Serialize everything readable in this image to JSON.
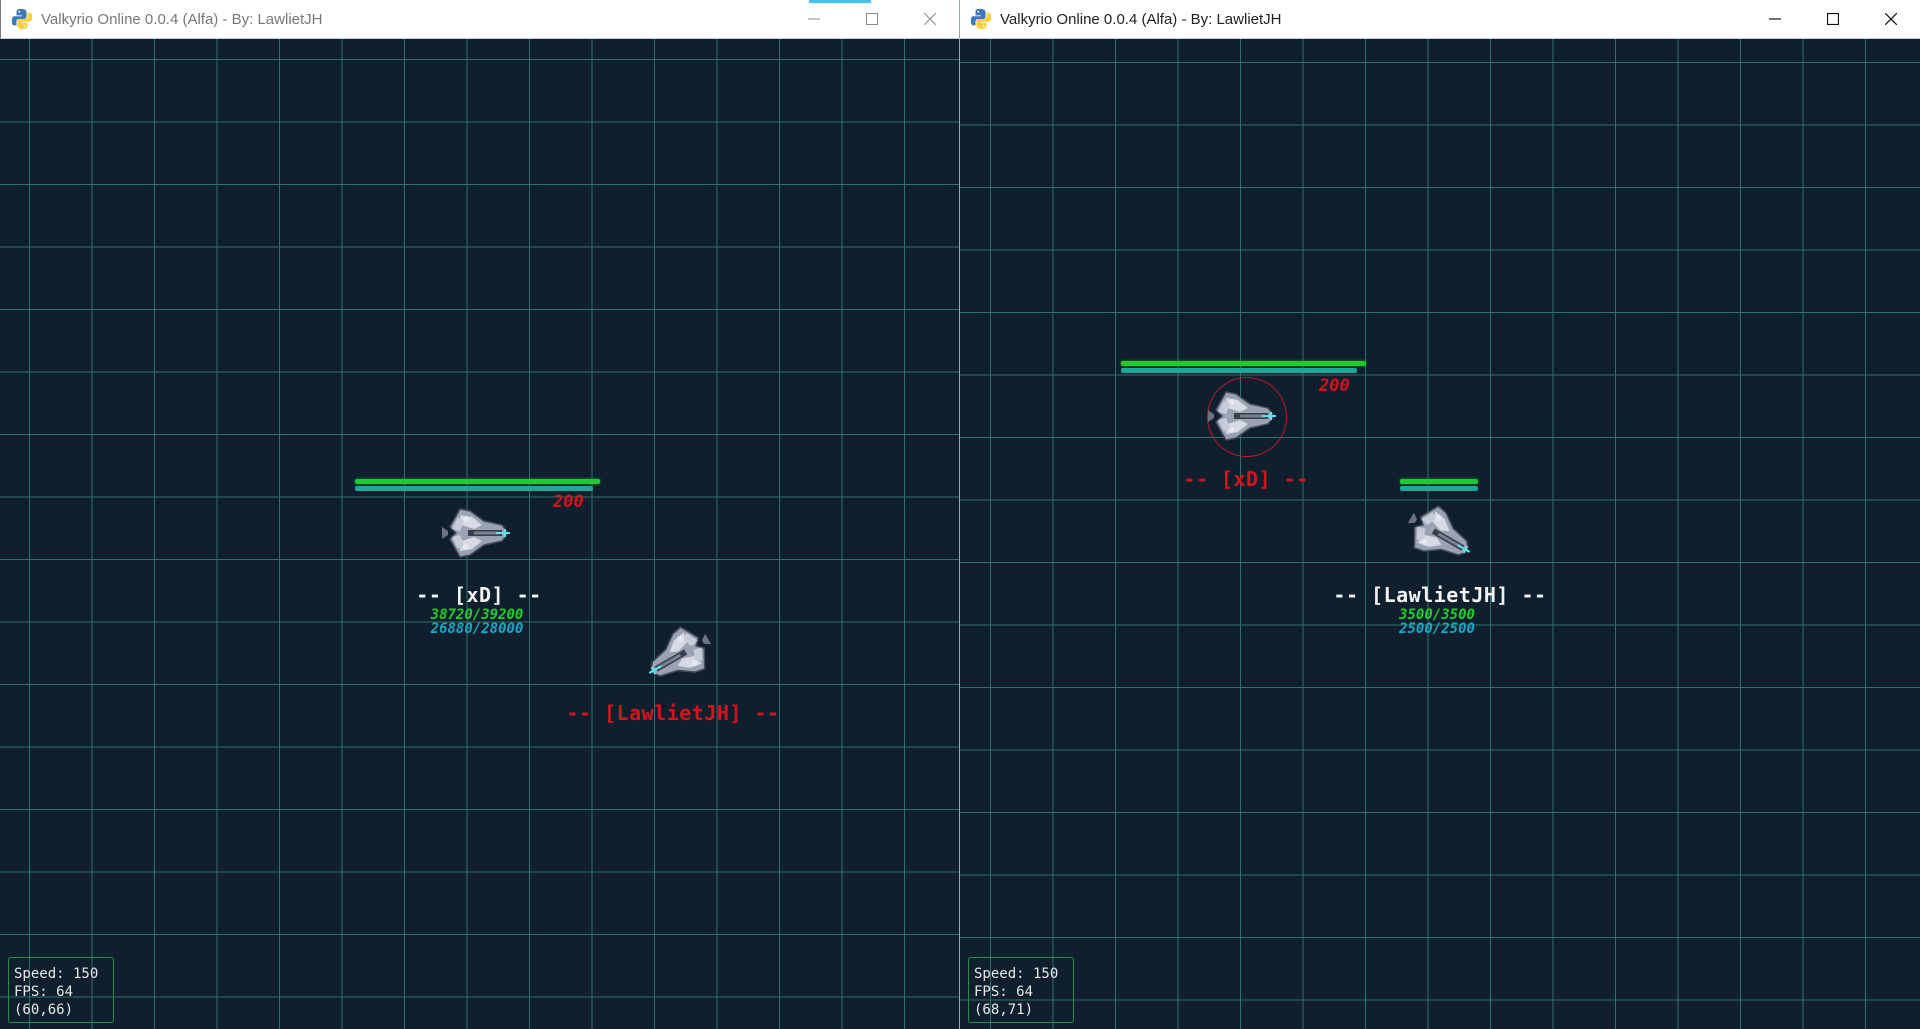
{
  "windows": [
    {
      "id": "left",
      "title": "Valkyrio Online 0.0.4 (Alfa) - By: LawlietJH",
      "focused": false,
      "self_ship": {
        "name_tag": "-- [xD] --",
        "damage_text": "200",
        "hp_text": "38720/39200",
        "sp_text": "26880/28000",
        "hp_fraction": 0.988,
        "sp_fraction": 0.96
      },
      "enemy_ship": {
        "name_tag": "-- [LawlietJH] --"
      },
      "hud": {
        "speed": "Speed: 150",
        "fps": "FPS: 64",
        "coords": "(60,66)"
      }
    },
    {
      "id": "right",
      "title": "Valkyrio Online 0.0.4 (Alfa) - By: LawlietJH",
      "focused": true,
      "self_ship": {
        "name_tag": "-- [LawlietJH] --",
        "hp_text": "3500/3500",
        "sp_text": "2500/2500",
        "hp_fraction": 1.0,
        "sp_fraction": 1.0
      },
      "enemy_ship": {
        "name_tag": "-- [xD] --",
        "damage_text": "200",
        "hp_fraction": 0.988,
        "sp_fraction": 0.96,
        "targeted": true
      },
      "hud": {
        "speed": "Speed: 150",
        "fps": "FPS: 64",
        "coords": "(68,71)"
      }
    }
  ],
  "colors": {
    "background": "#0f1f2d",
    "grid": "#2f6f6c",
    "hp": "#22c933",
    "shield": "#1ea89a",
    "enemy": "#d4141b",
    "self_name": "#f2f2f2"
  },
  "icons": {
    "app": "python-icon",
    "minimize": "minimize-icon",
    "maximize": "maximize-icon",
    "close": "close-icon"
  }
}
